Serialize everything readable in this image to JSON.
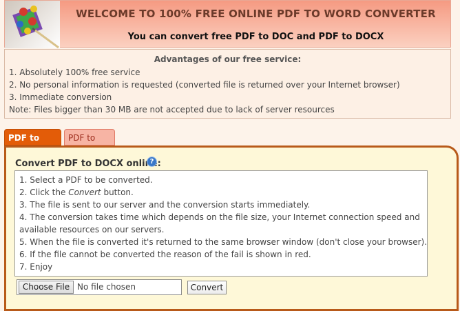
{
  "header": {
    "title": "WELCOME TO 100% FREE ONLINE PDF TO WORD CONVERTER",
    "subtitle": "You can convert free PDF to DOC and PDF to DOCX",
    "logo_icon": "pdf-to-word-logo"
  },
  "advantages": {
    "title": "Advantages of our free service:",
    "items": [
      "1. Absolutely 100% free service",
      "2. No personal information is requested (converted file is returned over your Internet browser)",
      "3. Immediate conversion",
      "Note: Files bigger than 30 MB are not accepted due to lack of server resources"
    ]
  },
  "tabs": [
    {
      "label": "PDF to DOCX",
      "active": true
    },
    {
      "label": "PDF to DOC",
      "active": false
    }
  ],
  "panel": {
    "title": "Convert PDF to DOCX online:",
    "help_icon": "help-icon",
    "steps": [
      {
        "pre": "1. Select a PDF to be converted.",
        "em": "",
        "post": ""
      },
      {
        "pre": "2. Click the ",
        "em": "Convert",
        "post": " button."
      },
      {
        "pre": "3. The file is sent to our server and the conversion starts immediately.",
        "em": "",
        "post": ""
      },
      {
        "pre": "4. The conversion takes time which depends on the file size, your Internet connection speed and",
        "em": "",
        "post": ""
      },
      {
        "pre": "available resources on our servers.",
        "em": "",
        "post": ""
      },
      {
        "pre": "5. When the file is converted it's returned to the same browser window (don't close your browser).",
        "em": "",
        "post": ""
      },
      {
        "pre": "6. If the file cannot be converted the reason of the fail is shown in red.",
        "em": "",
        "post": ""
      },
      {
        "pre": "7. Enjoy",
        "em": "",
        "post": ""
      }
    ],
    "file_input": {
      "button_label": "Choose File",
      "status": "No file chosen"
    },
    "convert_label": "Convert"
  },
  "colors": {
    "accent": "#e35c08",
    "panel_border": "#b85a1a",
    "panel_bg": "#fef8d8",
    "header_bg": "#f59a82"
  }
}
